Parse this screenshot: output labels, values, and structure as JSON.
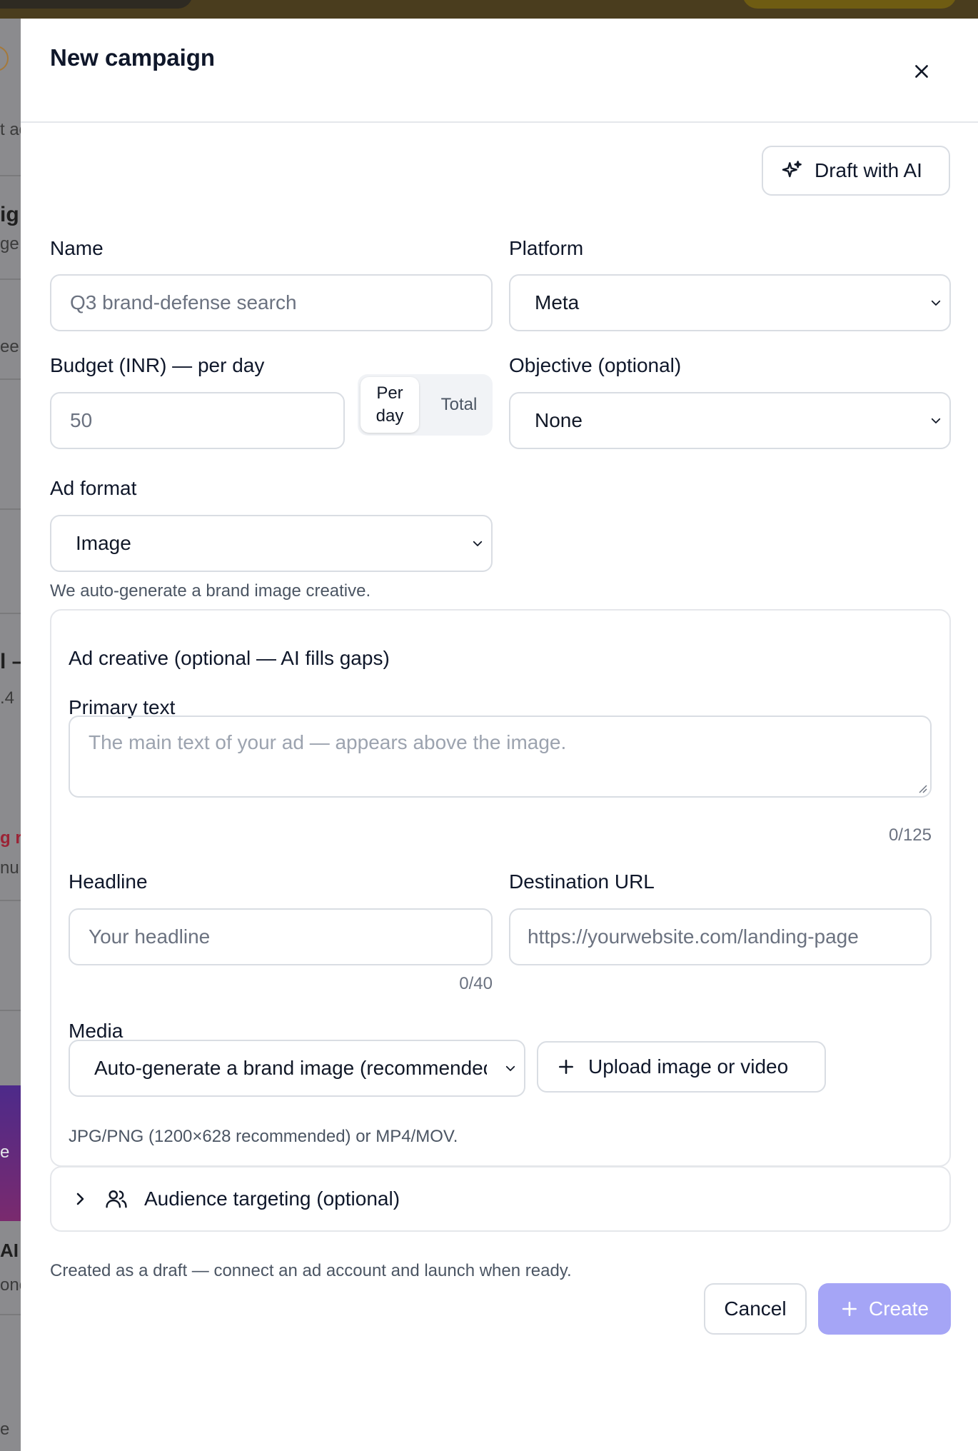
{
  "background": {
    "fragments": [
      "t ac",
      "ig",
      "ge",
      "ee",
      "l –",
      ".4",
      "g r",
      "nu",
      "e",
      "AI",
      "onc",
      "e"
    ]
  },
  "modal": {
    "title": "New campaign",
    "close_icon": "close-icon",
    "draft_ai_label": "Draft with AI",
    "name": {
      "label": "Name",
      "placeholder": "Q3 brand-defense search",
      "value": ""
    },
    "platform": {
      "label": "Platform",
      "selected": "Meta"
    },
    "budget": {
      "label": "Budget (INR) — per day",
      "placeholder": "50",
      "toggle": {
        "active": "Per day",
        "inactive": "Total"
      }
    },
    "objective": {
      "label": "Objective (optional)",
      "selected": "None"
    },
    "ad_format": {
      "label": "Ad format",
      "selected": "Image",
      "help": "We auto-generate a brand image creative."
    },
    "creative": {
      "title": "Ad creative (optional — AI fills gaps)",
      "primary_text": {
        "label": "Primary text",
        "placeholder": "The main text of your ad — appears above the image.",
        "counter": "0/125"
      },
      "headline": {
        "label": "Headline",
        "placeholder": "Your headline",
        "counter": "0/40"
      },
      "destination": {
        "label": "Destination URL",
        "placeholder": "https://yourwebsite.com/landing-page"
      },
      "media": {
        "label": "Media",
        "selected": "Auto-generate a brand image (recommended)",
        "upload_label": "Upload image or video",
        "help": "JPG/PNG (1200×628 recommended) or MP4/MOV."
      }
    },
    "audience_label": "Audience targeting (optional)",
    "footer_note": "Created as a draft — connect an ad account and launch when ready.",
    "cancel_label": "Cancel",
    "create_label": "Create"
  },
  "colors": {
    "accent_disabled": "#a5a5f6",
    "border": "#d9dde3",
    "text": "#0f172a",
    "muted": "#4b5563"
  }
}
